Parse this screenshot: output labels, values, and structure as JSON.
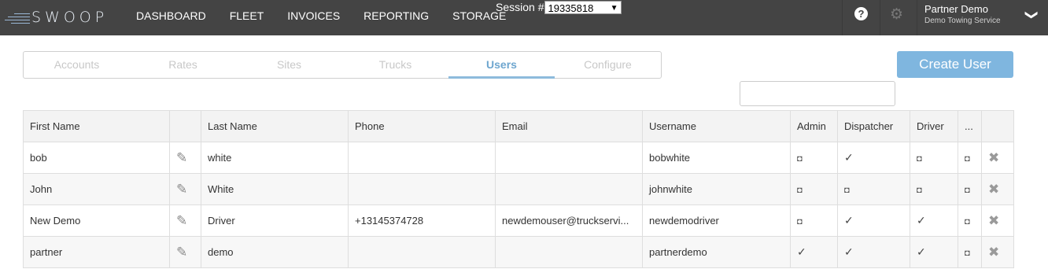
{
  "app": {
    "logo_text": "SWOOP",
    "nav": [
      "DASHBOARD",
      "FLEET",
      "INVOICES",
      "REPORTING",
      "STORAGE"
    ],
    "session_label": "Session #",
    "session_value": "19335818",
    "user_name": "Partner Demo",
    "user_company": "Demo Towing Service"
  },
  "icons": {
    "help": "?",
    "gear": "⚙",
    "chevron": "❯",
    "caret": "▼",
    "edit": "✎",
    "delete": "✖",
    "unchecked": "◘",
    "checked": "✓"
  },
  "tabs": [
    "Accounts",
    "Rates",
    "Sites",
    "Trucks",
    "Users",
    "Configure"
  ],
  "active_tab": "Users",
  "create_button": "Create User",
  "search": {
    "placeholder": ""
  },
  "table": {
    "headers": [
      "First Name",
      "",
      "Last Name",
      "Phone",
      "Email",
      "Username",
      "Admin",
      "Dispatcher",
      "Driver",
      "...",
      ""
    ],
    "rows": [
      {
        "first": "bob",
        "last": "white",
        "phone": "",
        "email": "",
        "username": "bobwhite",
        "admin": false,
        "dispatcher": true,
        "driver": false,
        "extra": false
      },
      {
        "first": "John",
        "last": "White",
        "phone": "",
        "email": "",
        "username": "johnwhite",
        "admin": false,
        "dispatcher": false,
        "driver": false,
        "extra": false
      },
      {
        "first": "New Demo",
        "last": "Driver",
        "phone": "+13145374728",
        "email": "newdemouser@truckservi...",
        "username": "newdemodriver",
        "admin": false,
        "dispatcher": true,
        "driver": true,
        "extra": false
      },
      {
        "first": "partner",
        "last": "demo",
        "phone": "",
        "email": "",
        "username": "partnerdemo",
        "admin": true,
        "dispatcher": true,
        "driver": true,
        "extra": false
      }
    ]
  },
  "colors": {
    "topbar": "#444444",
    "accent": "#7fb6df",
    "active_tab": "#6ea6cf"
  }
}
